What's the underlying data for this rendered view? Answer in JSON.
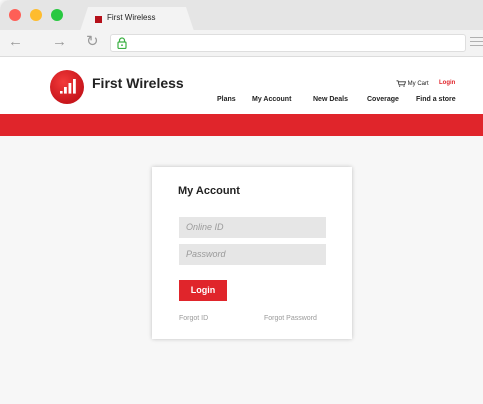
{
  "browser": {
    "tab_title": "First Wireless",
    "address": "",
    "colors": {
      "traffic_red": "#fe5f57",
      "traffic_yellow": "#febc2e",
      "traffic_green": "#28c840",
      "favicon": "#b5101a"
    }
  },
  "site": {
    "brand": "First Wireless",
    "cart_label": "My Cart",
    "login_label": "Login",
    "nav": [
      "Plans",
      "My Account",
      "New Deals",
      "Coverage",
      "Find a store"
    ],
    "accent_color": "#e0252b"
  },
  "login_card": {
    "title": "My Account",
    "online_id_placeholder": "Online ID",
    "password_placeholder": "Password",
    "login_button": "Login",
    "forgot_id": "Forgot ID",
    "forgot_password": "Forgot Password"
  }
}
